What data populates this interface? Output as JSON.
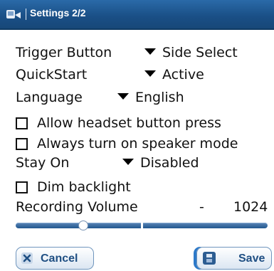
{
  "window": {
    "title": "Settings 2/2"
  },
  "settings": {
    "trigger_button": {
      "label": "Trigger Button",
      "value": "Side Select"
    },
    "quickstart": {
      "label": "QuickStart",
      "value": "Active"
    },
    "language": {
      "label": "Language",
      "value": "English"
    },
    "allow_headset": {
      "label": "Allow headset button press",
      "checked": false
    },
    "speaker_mode": {
      "label": "Always turn on speaker mode",
      "checked": false
    },
    "stay_on": {
      "label": "Stay On",
      "value": "Disabled"
    },
    "dim_backlight": {
      "label": "Dim backlight",
      "checked": false
    },
    "recording_volume": {
      "label": "Recording Volume",
      "dash": "-",
      "value": "1024"
    }
  },
  "buttons": {
    "cancel": "Cancel",
    "save": "Save"
  },
  "icons": {
    "app": "phone-app-icon",
    "dropdown": "dropdown-triangle-icon",
    "cancel": "x-close-icon",
    "save": "floppy-save-icon"
  },
  "colors": {
    "titlebar": "#1a4f86",
    "accent": "#2c79c9",
    "button_text": "#1f4f83"
  }
}
